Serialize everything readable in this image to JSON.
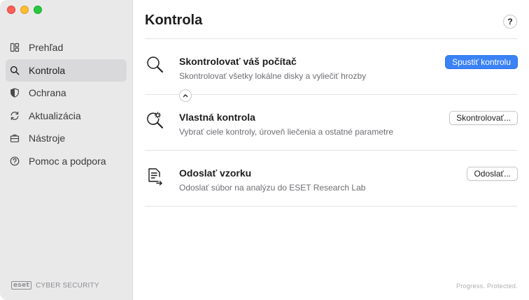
{
  "window": {
    "traffic_lights": [
      "close",
      "minimize",
      "maximize"
    ]
  },
  "sidebar": {
    "items": [
      {
        "label": "Prehľad",
        "icon": "dashboard-icon"
      },
      {
        "label": "Kontrola",
        "icon": "search-icon",
        "active": true
      },
      {
        "label": "Ochrana",
        "icon": "shield-icon"
      },
      {
        "label": "Aktualizácia",
        "icon": "refresh-icon"
      },
      {
        "label": "Nástroje",
        "icon": "briefcase-icon"
      },
      {
        "label": "Pomoc a podpora",
        "icon": "help-circle-icon"
      }
    ],
    "brand": {
      "logo": "eset",
      "product": "CYBER SECURITY"
    }
  },
  "main": {
    "title": "Kontrola",
    "help_label": "?",
    "rows": [
      {
        "title": "Skontrolovať váš počítač",
        "description": "Skontrolovať všetky lokálne disky a vyliečiť hrozby",
        "button": "Spustiť kontrolu",
        "icon": "magnifier-icon"
      },
      {
        "title": "Vlastná kontrola",
        "description": "Vybrať ciele kontroly, úroveň liečenia a ostatné parametre",
        "button": "Skontrolovať...",
        "icon": "custom-scan-icon"
      },
      {
        "title": "Odoslať vzorku",
        "description": "Odoslať súbor na analýzu do ESET Research Lab",
        "button": "Odoslať...",
        "icon": "submit-document-icon"
      }
    ],
    "footer": "Progress. Protected."
  },
  "colors": {
    "accent": "#3b82f6",
    "sidebar_bg": "#e9e9ea",
    "active_item": "#d9d9db"
  }
}
